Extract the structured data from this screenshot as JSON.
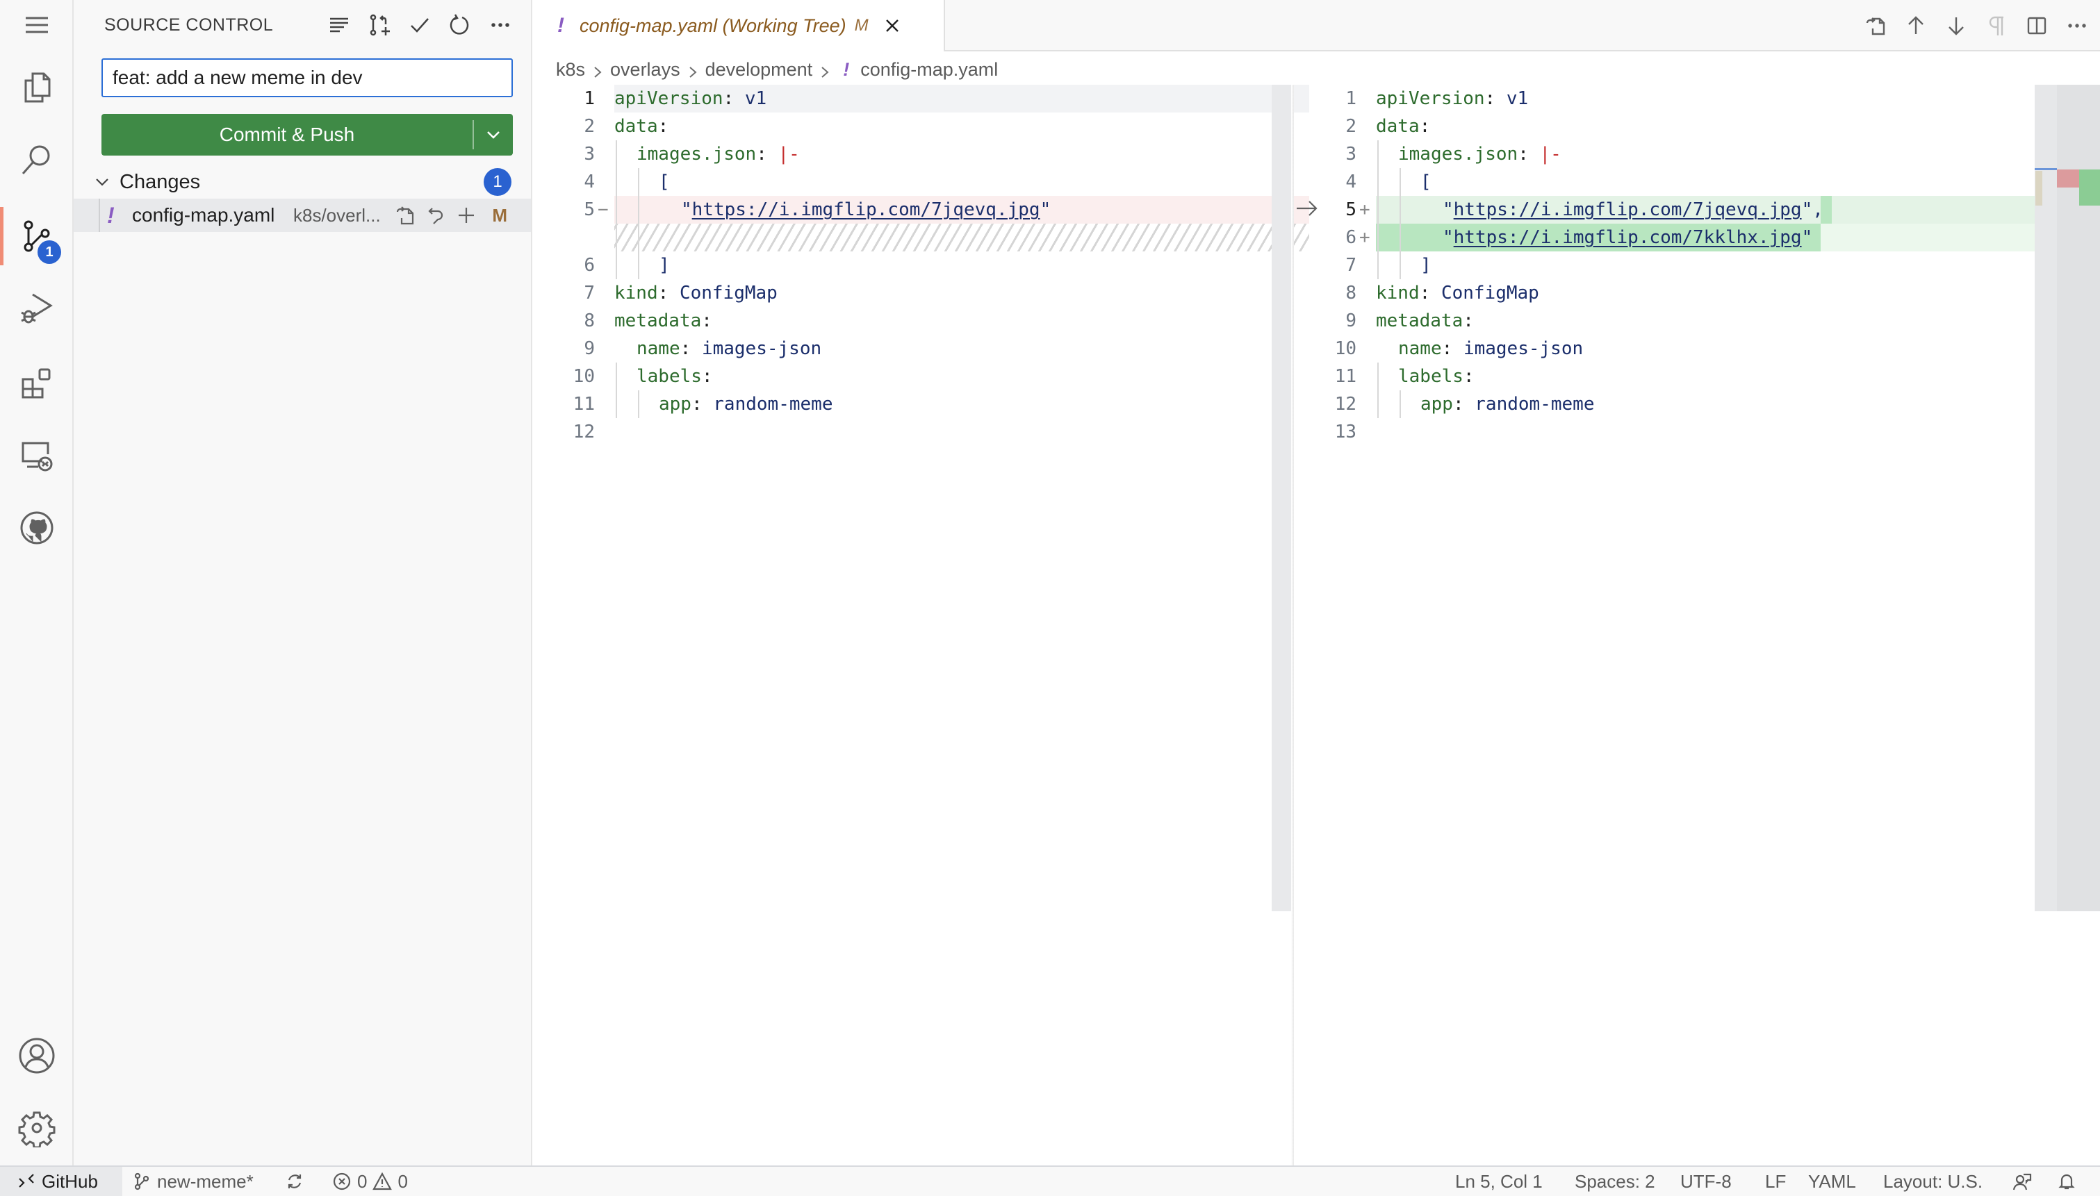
{
  "activity_bar": {
    "items": [
      {
        "name": "menu",
        "icon": "hamburger-menu-icon"
      },
      {
        "name": "explorer",
        "icon": "files-icon"
      },
      {
        "name": "search",
        "icon": "search-icon"
      },
      {
        "name": "source-control",
        "icon": "source-control-icon",
        "active": true,
        "badge": "1"
      },
      {
        "name": "run-debug",
        "icon": "run-debug-icon"
      },
      {
        "name": "extensions",
        "icon": "extensions-icon"
      },
      {
        "name": "remote-explorer",
        "icon": "remote-explorer-icon"
      },
      {
        "name": "github",
        "icon": "github-icon"
      }
    ],
    "bottom": [
      {
        "name": "accounts",
        "icon": "account-icon"
      },
      {
        "name": "manage",
        "icon": "gear-icon"
      }
    ],
    "scm_badge": "1"
  },
  "sidebar": {
    "title": "SOURCE CONTROL",
    "actions": [
      "view-as-tree",
      "create-pull-request",
      "commit",
      "refresh",
      "more-actions"
    ],
    "commit_message": "feat: add a new meme in dev",
    "commit_button_label": "Commit & Push",
    "changes_label": "Changes",
    "changes_count": "1",
    "files": [
      {
        "icon_glyph": "!",
        "name": "config-map.yaml",
        "path": "k8s/overl...",
        "status": "M"
      }
    ]
  },
  "editor": {
    "tab": {
      "icon_glyph": "!",
      "title": "config-map.yaml (Working Tree)",
      "status": "M"
    },
    "breadcrumb": [
      "k8s",
      "overlays",
      "development",
      "config-map.yaml"
    ],
    "breadcrumb_file_glyph": "!",
    "actions": [
      "open-file",
      "previous-change",
      "next-change",
      "show-whitespace",
      "split-editor",
      "more-actions"
    ],
    "left_lines": [
      {
        "n": "1",
        "mark": ""
      },
      {
        "n": "2",
        "mark": ""
      },
      {
        "n": "3",
        "mark": ""
      },
      {
        "n": "4",
        "mark": ""
      },
      {
        "n": "5",
        "mark": "−"
      },
      {
        "n": "6",
        "mark": ""
      },
      {
        "n": "7",
        "mark": ""
      },
      {
        "n": "8",
        "mark": ""
      },
      {
        "n": "9",
        "mark": ""
      },
      {
        "n": "10",
        "mark": ""
      },
      {
        "n": "11",
        "mark": ""
      },
      {
        "n": "12",
        "mark": ""
      }
    ],
    "right_lines": [
      {
        "n": "1",
        "mark": ""
      },
      {
        "n": "2",
        "mark": ""
      },
      {
        "n": "3",
        "mark": ""
      },
      {
        "n": "4",
        "mark": ""
      },
      {
        "n": "5",
        "mark": "+"
      },
      {
        "n": "6",
        "mark": "+"
      },
      {
        "n": "7",
        "mark": ""
      },
      {
        "n": "8",
        "mark": ""
      },
      {
        "n": "9",
        "mark": ""
      },
      {
        "n": "10",
        "mark": ""
      },
      {
        "n": "11",
        "mark": ""
      },
      {
        "n": "12",
        "mark": ""
      },
      {
        "n": "13",
        "mark": ""
      }
    ],
    "code": {
      "apiVersion_key": "apiVersion",
      "apiVersion_val": "v1",
      "data_key": "data",
      "images_key": "images.json",
      "block_indicator": "|-",
      "open_bracket": "[",
      "close_bracket": "]",
      "url1": "https://i.imgflip.com/7jqevq.jpg",
      "url2": "https://i.imgflip.com/7kklhx.jpg",
      "kind_key": "kind",
      "kind_val": "ConfigMap",
      "metadata_key": "metadata",
      "name_key": "name",
      "name_val": "images-json",
      "labels_key": "labels",
      "app_key": "app",
      "app_val": "random-meme"
    }
  },
  "statusbar": {
    "remote": "GitHub",
    "branch": "new-meme*",
    "errors": "0",
    "warnings": "0",
    "cursor": "Ln 5, Col 1",
    "spaces": "Spaces: 2",
    "encoding": "UTF-8",
    "eol": "LF",
    "language": "YAML",
    "layout": "Layout: U.S."
  },
  "colors": {
    "accent": "#2a62d0",
    "commit_button": "#3f8a46",
    "active_indicator": "#f08c75",
    "modified": "#9a6e3a",
    "deleted_bg": "#fbeeee",
    "inserted_bg": "#b8e6c0"
  }
}
